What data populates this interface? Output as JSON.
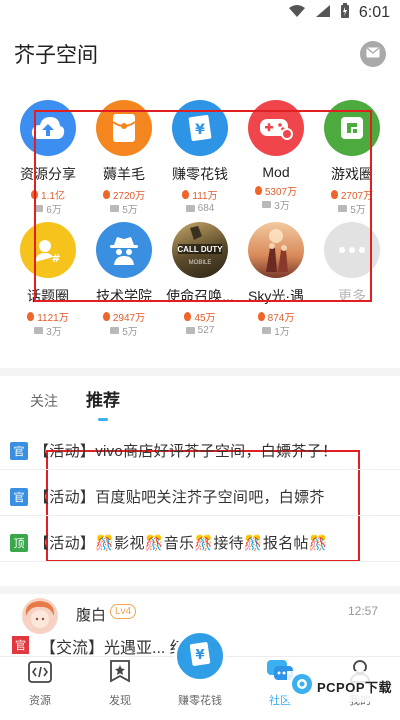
{
  "status": {
    "time": "6:01"
  },
  "header": {
    "title": "芥子空间",
    "mail_icon": "mail-icon"
  },
  "apps": [
    {
      "name": "资源分享",
      "hot": "1.1亿",
      "posts": "6万",
      "color": "#3c8ff0",
      "icon": "cloud-upload-icon"
    },
    {
      "name": "薅羊毛",
      "hot": "2720万",
      "posts": "5万",
      "color": "#f4851f",
      "icon": "red-envelope-icon"
    },
    {
      "name": "赚零花钱",
      "hot": "111万",
      "posts": "684",
      "color": "#2d94e6",
      "icon": "money-icon"
    },
    {
      "name": "Mod",
      "hot": "5307万",
      "posts": "3万",
      "color": "#f0454a",
      "icon": "gamepad-icon"
    },
    {
      "name": "游戏圈",
      "hot": "2707万",
      "posts": "5万",
      "color": "#4caa3f",
      "icon": "shutter-icon"
    },
    {
      "name": "话题圈",
      "hot": "1121万",
      "posts": "3万",
      "color": "#f6c21c",
      "icon": "topic-icon"
    },
    {
      "name": "技术学院",
      "hot": "2947万",
      "posts": "5万",
      "color": "#3a8fe0",
      "icon": "spy-icon"
    },
    {
      "name": "使命召唤...",
      "hot": "45万",
      "posts": "527",
      "color": "#5a4a2a",
      "icon": "call-of-duty-icon"
    },
    {
      "name": "Sky光·遇",
      "hot": "874万",
      "posts": "1万",
      "color": "#d98a5a",
      "icon": "sky-icon"
    },
    {
      "name": "更多",
      "hot": "",
      "posts": "",
      "color": "#e2e2e2",
      "icon": "more-icon"
    }
  ],
  "tabs": {
    "follow": "关注",
    "recommend": "推荐"
  },
  "announcements": [
    {
      "badge": "官",
      "badge_color": "#3a8fe0",
      "text": "【活动】vivo商店好评芥子空间，白嫖芥子！"
    },
    {
      "badge": "官",
      "badge_color": "#3a8fe0",
      "text": "【活动】百度贴吧关注芥子空间吧，白嫖芥"
    },
    {
      "badge": "顶",
      "badge_color": "#3aa84a",
      "text": "【活动】🎊影视🎊音乐🎊接待🎊报名帖🎊"
    }
  ],
  "post": {
    "user": "腹白",
    "level": "4",
    "time": "12:57",
    "tag": "官",
    "title": "【交流】光遇亚... 红蝴蝶"
  },
  "bottom_nav": {
    "resources": "资源",
    "discover": "发现",
    "earn": "赚零花钱",
    "community": "社区",
    "mine": "我的"
  },
  "watermark": "PCPOP下载"
}
